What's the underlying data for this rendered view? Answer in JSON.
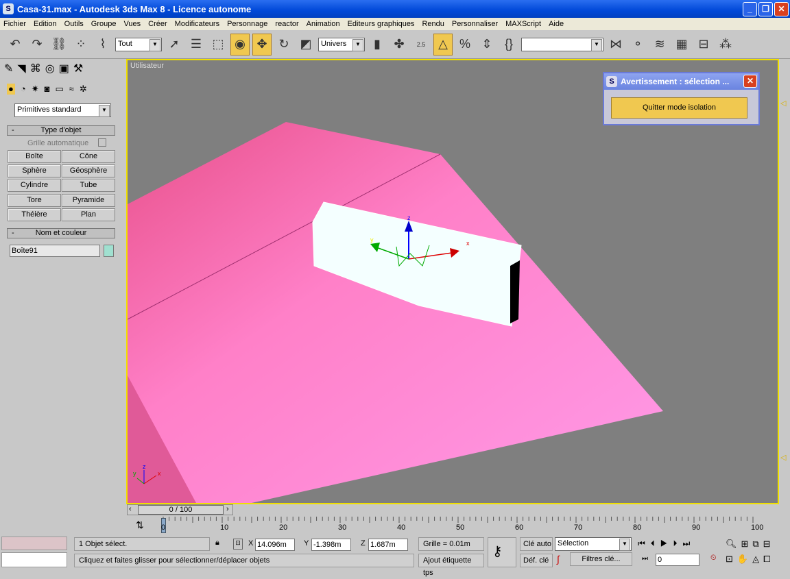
{
  "window": {
    "title": "Casa-31.max - Autodesk 3ds Max 8  - Licence autonome",
    "minimize": "_",
    "restore": "❐",
    "close": "✕"
  },
  "menu": [
    "Fichier",
    "Edition",
    "Outils",
    "Groupe",
    "Vues",
    "Créer",
    "Modificateurs",
    "Personnage",
    "reactor",
    "Animation",
    "Editeurs graphiques",
    "Rendu",
    "Personnaliser",
    "MAXScript",
    "Aide"
  ],
  "toolbar": {
    "selection_filter": "Tout",
    "reference_coord": "Univers",
    "snap_label": "2.5",
    "named_selection": ""
  },
  "command_panel": {
    "category": "Primitives standard",
    "object_type_header": "Type d'objet",
    "auto_grid": "Grille automatique",
    "buttons": [
      "Boîte",
      "Cône",
      "Sphère",
      "Géosphère",
      "Cylindre",
      "Tube",
      "Tore",
      "Pyramide",
      "Théière",
      "Plan"
    ],
    "name_color_header": "Nom et couleur",
    "object_name": "Boîte91",
    "object_color": "#a0e0d0",
    "collapse": "-"
  },
  "viewport": {
    "label": "Utilisateur",
    "axis": {
      "x": "x",
      "y": "y",
      "z": "z"
    }
  },
  "dialog": {
    "title": "Avertissement : sélection ...",
    "button": "Quitter mode isolation",
    "close": "✕"
  },
  "timeline": {
    "frame": "0 / 100",
    "ticks": [
      "0",
      "10",
      "20",
      "30",
      "40",
      "50",
      "60",
      "70",
      "80",
      "90",
      "100"
    ]
  },
  "status": {
    "selected": "1 Objet sélect.",
    "prompt": "Cliquez et faites glisser pour sélectionner/déplacer objets",
    "x_label": "X",
    "x": "14.096m",
    "y_label": "Y",
    "y": "-1.398m",
    "z_label": "Z",
    "z": "1.687m",
    "grid": "Grille = 0.01m",
    "add_tag": "Ajout étiquette tps",
    "auto_key": "Clé auto",
    "set_key": "Déf. clé",
    "key_mode": "Sélection",
    "key_filters": "Filtres clé...",
    "current_frame": "0"
  },
  "colors": {
    "accent": "#f0c850",
    "viewport_border": "#f0e000",
    "plane": "#ff88cc"
  }
}
